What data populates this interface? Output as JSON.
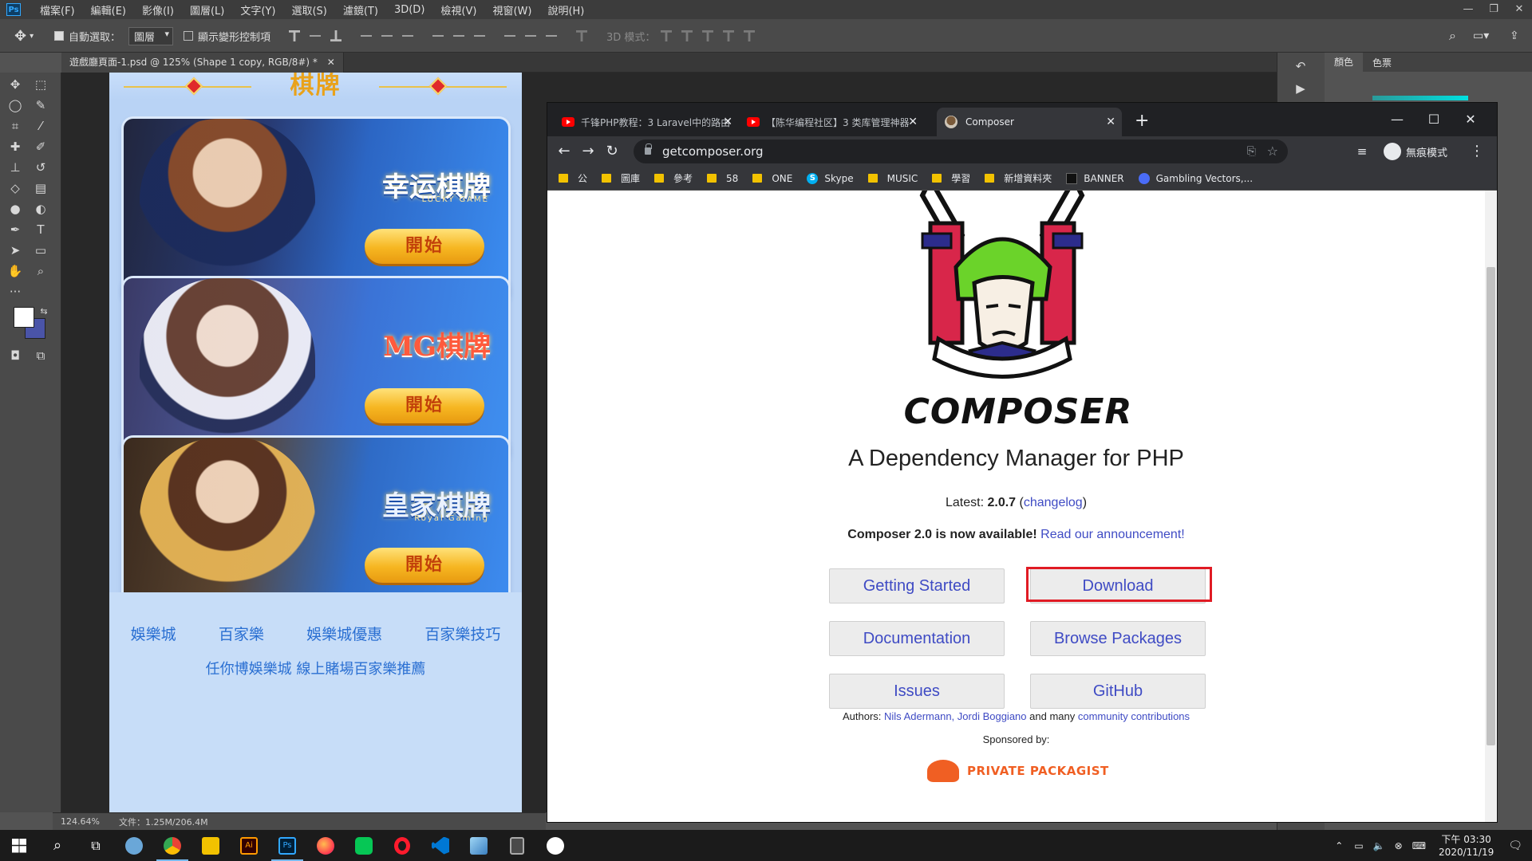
{
  "photoshop": {
    "logo": "Ps",
    "menu": [
      "檔案(F)",
      "編輯(E)",
      "影像(I)",
      "圖層(L)",
      "文字(Y)",
      "選取(S)",
      "濾鏡(T)",
      "3D(D)",
      "檢視(V)",
      "視窗(W)",
      "說明(H)"
    ],
    "options": {
      "auto_select_label": "自動選取：",
      "auto_select_value": "圖層",
      "show_transform_label": "顯示變形控制項",
      "mode3d_label": "3D 模式："
    },
    "doc_tab": "遊戲廳頁面-1.psd @ 125% (Shape 1 copy, RGB/8#) *",
    "status": {
      "zoom": "124.64%",
      "file": "文件：1.25M/206.4M"
    },
    "panel_tabs": [
      "顏色",
      "色票"
    ],
    "colors": {
      "foreground": "#ffffff",
      "background": "#4a54a8"
    }
  },
  "design": {
    "title": "棋牌",
    "cards": [
      {
        "brand": "幸运棋牌",
        "sub": "LUCKY GAME",
        "button": "開始"
      },
      {
        "brand": "MG棋牌",
        "sub": "",
        "button": "開始"
      },
      {
        "brand": "皇家棋牌",
        "sub": "Royal Gaming",
        "button": "開始"
      }
    ],
    "footer_links": [
      "娛樂城",
      "百家樂",
      "娛樂城優惠",
      "百家樂技巧"
    ],
    "footer_note": "任你博娛樂城 線上賭場百家樂推薦"
  },
  "browser": {
    "tabs": [
      {
        "title": "千锋PHP教程：3 Laravel中的路由",
        "icon": "youtube-icon"
      },
      {
        "title": "【陈华编程社区】3 类库管理神器",
        "icon": "youtube-icon"
      },
      {
        "title": "Composer",
        "icon": "composer-icon"
      }
    ],
    "url": "getcomposer.org",
    "profile": "無痕模式",
    "bookmarks": [
      {
        "label": "公",
        "icon": "folder-icon"
      },
      {
        "label": "圖庫",
        "icon": "folder-icon"
      },
      {
        "label": "參考",
        "icon": "folder-icon"
      },
      {
        "label": "58",
        "icon": "folder-icon"
      },
      {
        "label": "ONE",
        "icon": "folder-icon"
      },
      {
        "label": "Skype",
        "icon": "skype-icon"
      },
      {
        "label": "MUSIC",
        "icon": "folder-icon"
      },
      {
        "label": "學習",
        "icon": "folder-icon"
      },
      {
        "label": "新增資料夾",
        "icon": "folder-icon"
      },
      {
        "label": "BANNER",
        "icon": "banner-icon"
      },
      {
        "label": "Gambling Vectors,...",
        "icon": "globe-icon"
      }
    ]
  },
  "page": {
    "logo_text": "COMPOSER",
    "tagline": "A Dependency Manager for PHP",
    "latest_label": "Latest:",
    "latest_version": "2.0.7",
    "changelog": "changelog",
    "announce_bold": "Composer 2.0 is now available!",
    "announce_link": "Read our announcement!",
    "buttons": {
      "getting_started": "Getting Started",
      "download": "Download",
      "documentation": "Documentation",
      "browse_packages": "Browse Packages",
      "issues": "Issues",
      "github": "GitHub"
    },
    "authors_label": "Authors:",
    "authors_names": "Nils Adermann, Jordi Boggiano",
    "authors_and": "and many",
    "authors_contrib": "community contributions",
    "sponsored": "Sponsored by:",
    "sponsor_name": "PRIVATE PACKAGIST",
    "highlight_color": "#e01b24"
  },
  "taskbar": {
    "time": "下午 03:30",
    "date": "2020/11/19"
  }
}
